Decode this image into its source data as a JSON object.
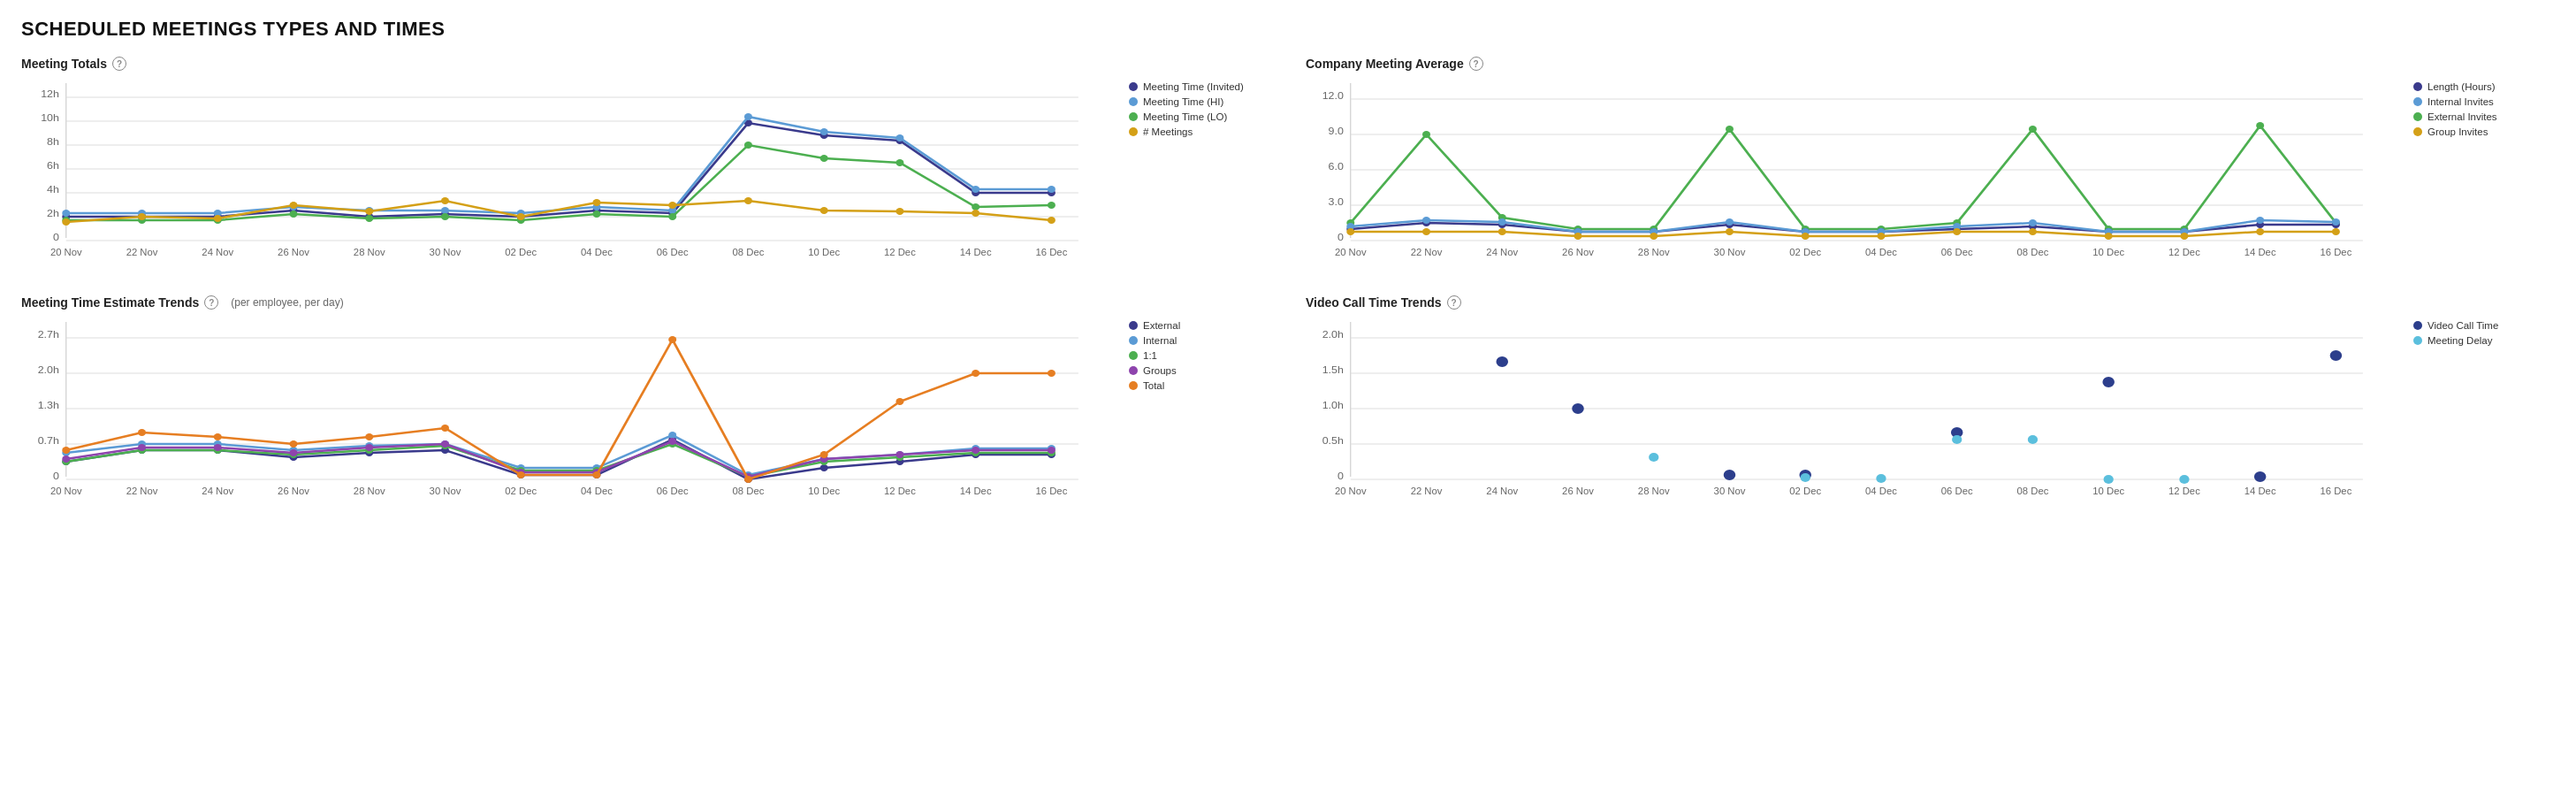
{
  "page": {
    "title": "SCHEDULED MEETINGS TYPES AND TIMES"
  },
  "charts": {
    "meeting_totals": {
      "title": "Meeting Totals",
      "legend": [
        {
          "label": "Meeting Time (Invited)",
          "color": "#3a3a8c"
        },
        {
          "label": "Meeting Time (HI)",
          "color": "#5b9bd5"
        },
        {
          "label": "Meeting Time (LO)",
          "color": "#4caf50"
        },
        {
          "label": "# Meetings",
          "color": "#f0c040"
        }
      ],
      "yAxis": [
        "0",
        "2h",
        "4h",
        "6h",
        "8h",
        "10h",
        "12h"
      ],
      "xAxis": [
        "20 Nov",
        "22 Nov",
        "24 Nov",
        "26 Nov",
        "28 Nov",
        "30 Nov",
        "02 Dec",
        "04 Dec",
        "06 Dec",
        "08 Dec",
        "10 Dec",
        "12 Dec",
        "14 Dec",
        "16 Dec"
      ]
    },
    "company_meeting_avg": {
      "title": "Company Meeting Average",
      "legend": [
        {
          "label": "Length (Hours)",
          "color": "#3a3a8c"
        },
        {
          "label": "Internal Invites",
          "color": "#5b9bd5"
        },
        {
          "label": "External Invites",
          "color": "#4caf50"
        },
        {
          "label": "Group Invites",
          "color": "#f0c040"
        }
      ],
      "yAxis": [
        "0",
        "3.0",
        "6.0",
        "9.0",
        "12.0"
      ],
      "xAxis": [
        "20 Nov",
        "22 Nov",
        "24 Nov",
        "26 Nov",
        "28 Nov",
        "30 Nov",
        "02 Dec",
        "04 Dec",
        "06 Dec",
        "08 Dec",
        "10 Dec",
        "12 Dec",
        "14 Dec",
        "16 Dec"
      ]
    },
    "meeting_time_trends": {
      "title": "Meeting Time Estimate Trends",
      "subtitle": "(per employee, per day)",
      "legend": [
        {
          "label": "External",
          "color": "#3a3a8c"
        },
        {
          "label": "Internal",
          "color": "#5b9bd5"
        },
        {
          "label": "1:1",
          "color": "#4caf50"
        },
        {
          "label": "Groups",
          "color": "#8e44ad"
        },
        {
          "label": "Total",
          "color": "#e67e22"
        }
      ],
      "yAxis": [
        "0",
        "0.7h",
        "1.3h",
        "2.0h",
        "2.7h"
      ],
      "xAxis": [
        "20 Nov",
        "22 Nov",
        "24 Nov",
        "26 Nov",
        "28 Nov",
        "30 Nov",
        "02 Dec",
        "04 Dec",
        "06 Dec",
        "08 Dec",
        "10 Dec",
        "12 Dec",
        "14 Dec",
        "16 Dec"
      ]
    },
    "video_call_trends": {
      "title": "Video Call Time Trends",
      "legend": [
        {
          "label": "Video Call Time",
          "color": "#2c3e8c"
        },
        {
          "label": "Meeting Delay",
          "color": "#5bbfdd"
        }
      ],
      "yAxis": [
        "0",
        "0.5h",
        "1.0h",
        "1.5h",
        "2.0h"
      ],
      "xAxis": [
        "20 Nov",
        "22 Nov",
        "24 Nov",
        "26 Nov",
        "28 Nov",
        "30 Nov",
        "02 Dec",
        "04 Dec",
        "06 Dec",
        "08 Dec",
        "10 Dec",
        "12 Dec",
        "14 Dec",
        "16 Dec"
      ]
    }
  }
}
